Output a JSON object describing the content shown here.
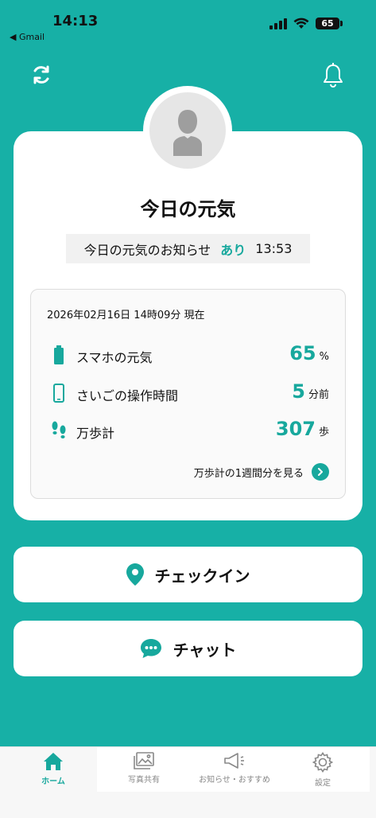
{
  "status_bar": {
    "time": "14:13",
    "back_app": "◀ Gmail",
    "battery": "65"
  },
  "header": {
    "refresh_icon": "refresh-icon",
    "bell_icon": "bell-icon"
  },
  "card": {
    "title": "今日の元気",
    "notice_label": "今日の元気のお知らせ",
    "notice_status": "あり",
    "notice_time": "13:53"
  },
  "stats": {
    "date": "2026年02月16日 14時09分 現在",
    "rows": [
      {
        "label": "スマホの元気",
        "value": "65",
        "unit": "%",
        "icon": "battery-icon"
      },
      {
        "label": "さいごの操作時間",
        "value": "5",
        "unit": "分前",
        "icon": "phone-icon"
      },
      {
        "label": "万歩計",
        "value": "307",
        "unit": "歩",
        "icon": "footprints-icon"
      }
    ],
    "weekly_link": "万歩計の1週間分を見る"
  },
  "actions": {
    "checkin": "チェックイン",
    "chat": "チャット"
  },
  "tabs": [
    {
      "label": "ホーム",
      "icon": "home-icon",
      "active": true
    },
    {
      "label": "写真共有",
      "icon": "photo-icon",
      "active": false
    },
    {
      "label": "お知らせ・おすすめ",
      "icon": "megaphone-icon",
      "active": false
    },
    {
      "label": "設定",
      "icon": "gear-icon",
      "active": false
    }
  ],
  "colors": {
    "accent": "#17b0a6",
    "accent_text": "#17a89d"
  }
}
